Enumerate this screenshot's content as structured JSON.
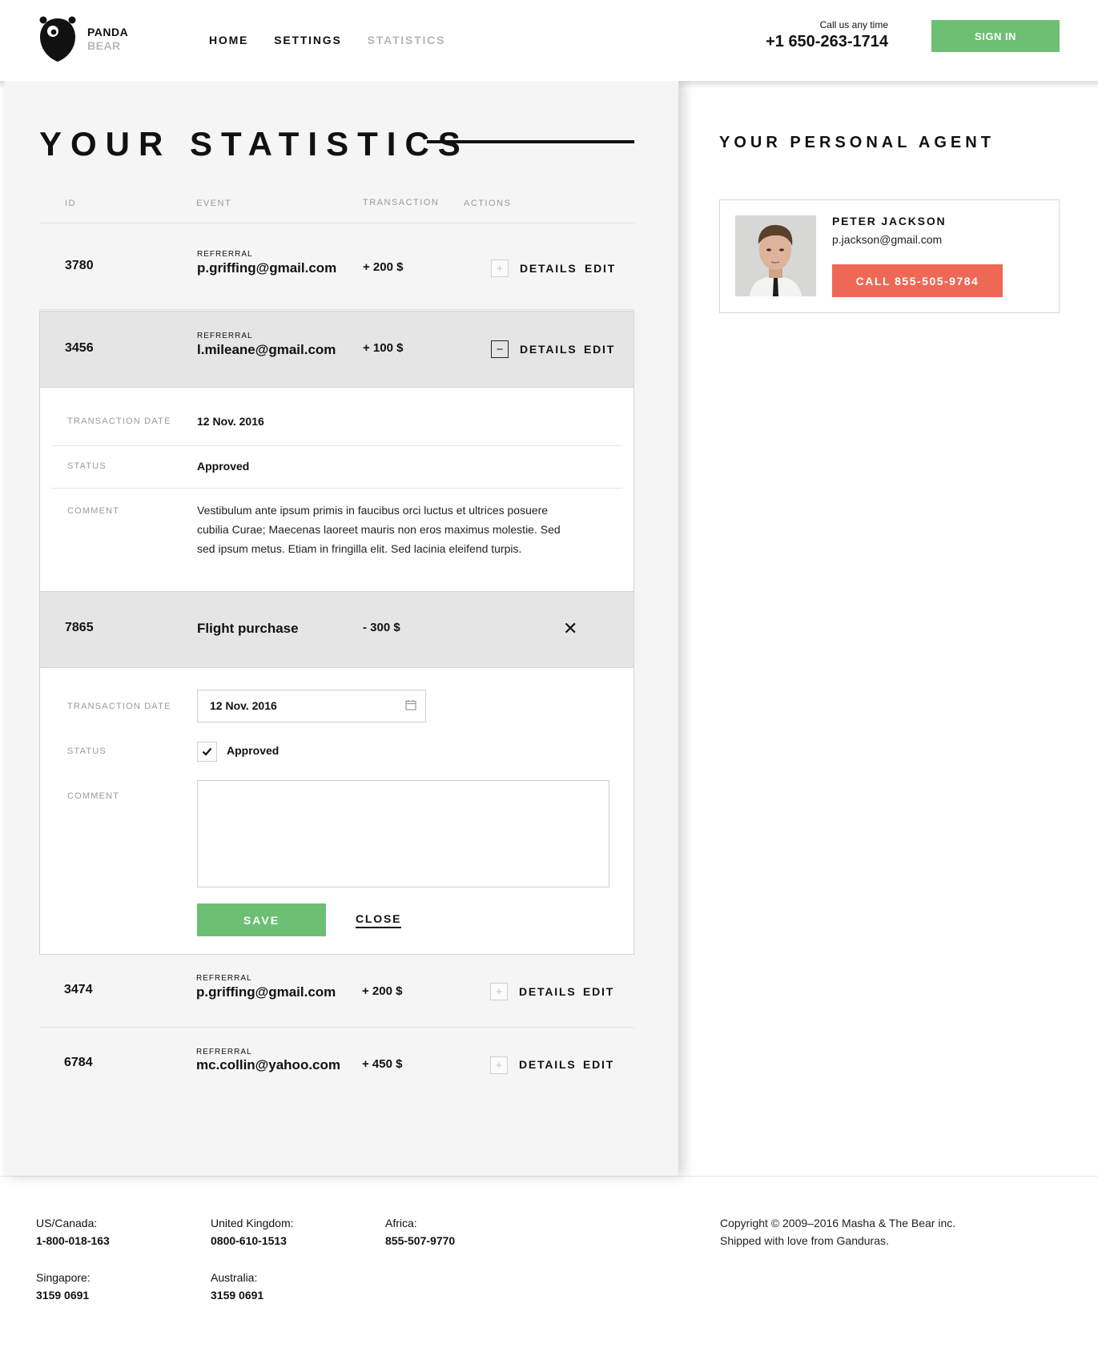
{
  "brand": {
    "name_top": "PANDA",
    "name_bottom": "BEAR"
  },
  "nav": {
    "items": [
      "HOME",
      "SETTINGS",
      "STATISTICS"
    ]
  },
  "contact": {
    "caption": "Call us any time",
    "phone": "+1 650-263-1714"
  },
  "header": {
    "signin_label": "SIGN IN"
  },
  "stats": {
    "title": "YOUR STATISTICS",
    "columns": [
      "ID",
      "EVENT",
      "TRANSACTION",
      "ACTIONS"
    ],
    "actions": {
      "details": "DETAILS",
      "edit": "EDIT"
    },
    "rows": [
      {
        "id": "3780",
        "event_type": "REFRERRAL",
        "event": "p.griffing@gmail.com",
        "amount": "+ 200 $"
      },
      {
        "id": "3456",
        "event_type": "REFRERRAL",
        "event": "l.mileane@gmail.com",
        "amount": "+ 100 $"
      },
      {
        "id": "7865",
        "event": "Flight purchase",
        "amount": "- 300 $"
      },
      {
        "id": "3474",
        "event_type": "REFRERRAL",
        "event": "p.griffing@gmail.com",
        "amount": "+ 200 $"
      },
      {
        "id": "6784",
        "event_type": "REFRERRAL",
        "event": "mc.collin@yahoo.com",
        "amount": "+ 450 $"
      }
    ],
    "details_view": {
      "date_label": "TRANSACTION DATE",
      "date": "12 Nov. 2016",
      "status_label": "STATUS",
      "status": "Approved",
      "comment_label": "COMMENT",
      "comment": "Vestibulum ante ipsum primis in faucibus orci luctus et ultrices posuere cubilia Curae; Maecenas laoreet mauris non eros maximus molestie. Sed sed ipsum metus. Etiam in fringilla elit. Sed lacinia eleifend turpis."
    },
    "edit_view": {
      "date_label": "TRANSACTION DATE",
      "date_value": "12 Nov. 2016",
      "status_label": "STATUS",
      "status_checked": true,
      "status_text": "Approved",
      "comment_label": "COMMENT",
      "comment_value": "",
      "save_label": "SAVE",
      "close_label": "CLOSE"
    }
  },
  "agent": {
    "section_title": "YOUR PERSONAL AGENT",
    "name": "PETER JACKSON",
    "email": "p.jackson@gmail.com",
    "call_label": "CALL 855-505-9784"
  },
  "footer": {
    "offices": [
      {
        "region": "US/Canada:",
        "phone": "1-800-018-163"
      },
      {
        "region": "United Kingdom:",
        "phone": "0800-610-1513"
      },
      {
        "region": "Africa:",
        "phone": "855-507-9770"
      },
      {
        "region": "Singapore:",
        "phone": "3159 0691"
      },
      {
        "region": "Australia:",
        "phone": "3159 0691"
      }
    ],
    "copyright": "Copyright © 2009–2016 Masha & The Bear inc.",
    "tagline": "Shipped with love from Ganduras."
  },
  "colors": {
    "green": "#6cbf73",
    "coral": "#ef6856",
    "panel": "#f5f5f5",
    "active_row": "#e5e5e5"
  },
  "icons": [
    "bear-logo-icon",
    "plus-icon",
    "minus-icon",
    "close-icon",
    "calendar-icon",
    "check-icon"
  ]
}
